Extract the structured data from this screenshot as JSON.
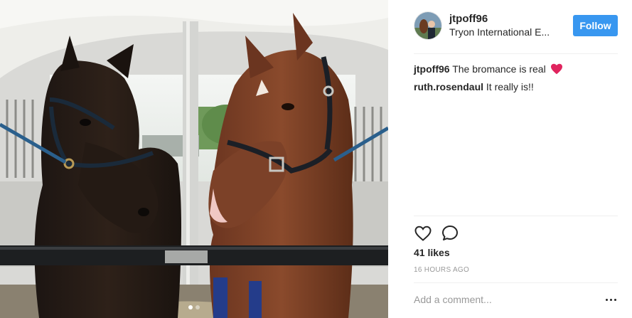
{
  "post": {
    "username": "jtpoff96",
    "location": "Tryon International E...",
    "follow_label": "Follow",
    "likes": "41 likes",
    "timestamp": "16 HOURS AGO",
    "comment_placeholder": "Add a comment...",
    "carousel": {
      "total": 2,
      "active_index": 0
    }
  },
  "comments": [
    {
      "user": "jtpoff96",
      "text": "The bromance is real",
      "emoji": "red-heart"
    },
    {
      "user": "ruth.rosendaul",
      "text": "It really is!!"
    }
  ],
  "icons": {
    "like": "heart-outline-icon",
    "comment": "speech-bubble-icon",
    "more": "more-options-icon"
  },
  "colors": {
    "follow_button": "#3897f0",
    "text": "#262626",
    "muted": "#999999",
    "divider": "#efefef",
    "heart_emoji": "#e0245e"
  }
}
